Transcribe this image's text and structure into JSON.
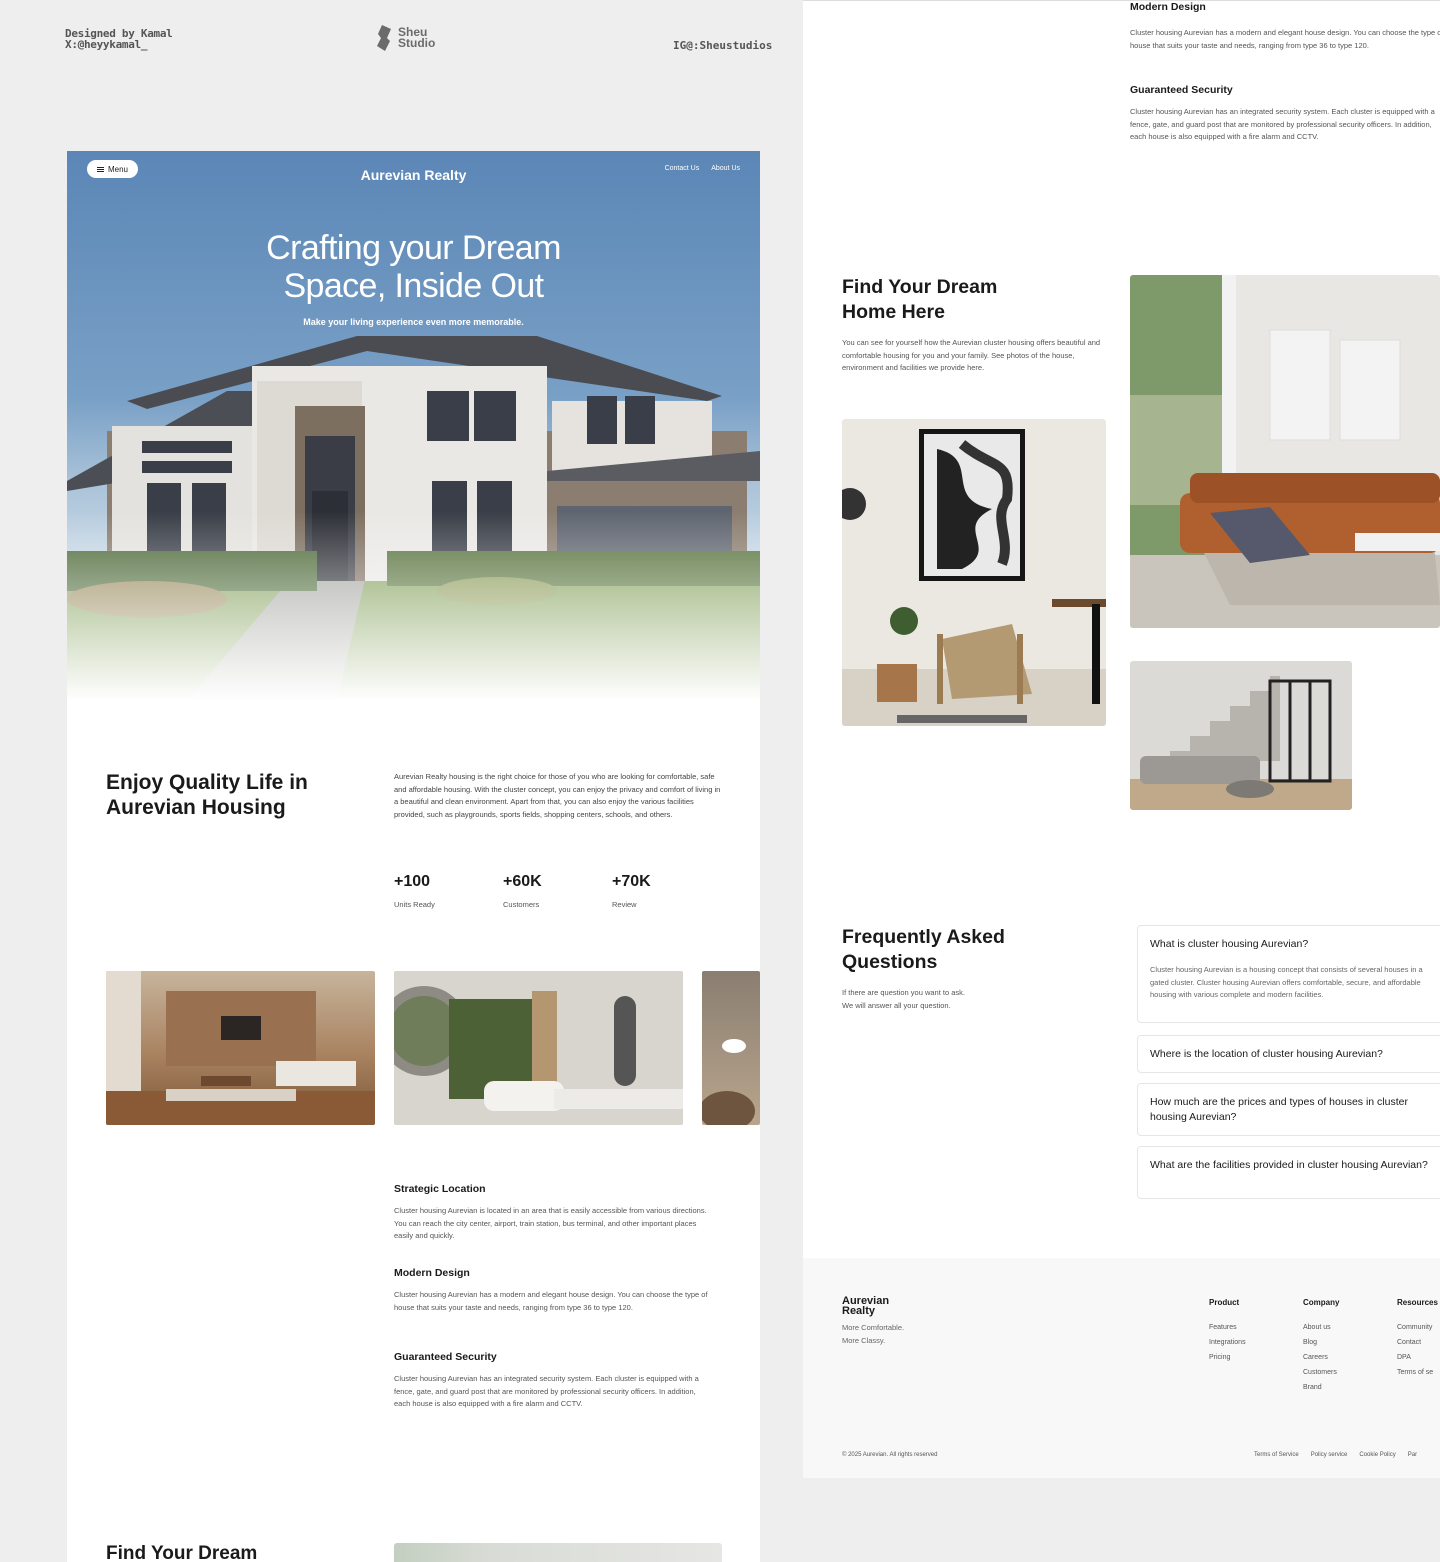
{
  "credits": {
    "designer": "Designed by Kamal",
    "x_handle": "X:@heyykamal_",
    "studio_line1": "Sheu",
    "studio_line2": "Studio",
    "instagram": "IG@:Sheustudios"
  },
  "site": {
    "menu_label": "Menu",
    "title": "Aurevian Realty",
    "nav": [
      "Contact Us",
      "About Us"
    ]
  },
  "hero": {
    "headline_line1": "Crafting your Dream",
    "headline_line2": "Space, Inside Out",
    "subtitle": "Make your living experience even more memorable."
  },
  "about": {
    "heading_line1": "Enjoy Quality Life in",
    "heading_line2": "Aurevian Housing",
    "body": "Aurevian Realty housing is the right choice for those of you who are looking for comfortable, safe and affordable housing. With the cluster concept, you can enjoy the privacy and comfort of living in a beautiful and clean environment. Apart from that, you can also enjoy the various facilities provided, such as playgrounds, sports fields, shopping centers, schools, and others.",
    "stats": [
      {
        "value": "+100",
        "label": "Units Ready"
      },
      {
        "value": "+60K",
        "label": "Customers"
      },
      {
        "value": "+70K",
        "label": "Review"
      }
    ]
  },
  "features": [
    {
      "title": "Strategic Location",
      "body": "Cluster housing Aurevian is located in an area that is easily accessible from various directions. You can reach the city center, airport, train station, bus terminal, and other important places easily and quickly."
    },
    {
      "title": "Modern Design",
      "body": "Cluster housing Aurevian has a modern and elegant house design. You can choose the type of house that suits your taste and needs, ranging from type 36 to type 120."
    },
    {
      "title": "Guaranteed Security",
      "body": "Cluster housing Aurevian has an integrated security system. Each cluster is equipped with a fence, gate, and guard post that are monitored by professional security officers. In addition, each house is also equipped with a fire alarm and CCTV."
    }
  ],
  "dream": {
    "heading_line1": "Find Your Dream",
    "heading_line2": "Home Here",
    "body": "You can see for yourself how the Aurevian cluster housing offers beautiful and comfortable housing for you and your family. See photos of the house, environment and facilities we provide here."
  },
  "faq": {
    "heading_line1": "Frequently Asked",
    "heading_line2": "Questions",
    "intro_line1": "If there are question you want to ask.",
    "intro_line2": "We will answer all your question.",
    "items": [
      {
        "q": "What is cluster housing Aurevian?",
        "a": "Cluster housing Aurevian is a housing concept that consists of several houses in a gated cluster. Cluster housing Aurevian offers comfortable, secure, and affordable housing with various complete and modern facilities.",
        "sign": "−"
      },
      {
        "q": "Where is the location of cluster housing Aurevian?",
        "sign": "+"
      },
      {
        "q": "How much are the prices and types of houses in cluster housing Aurevian?",
        "sign": "+"
      },
      {
        "q": "What are the facilities provided in cluster housing Aurevian?",
        "sign": "+"
      }
    ]
  },
  "footer": {
    "brand_line1": "Aurevian",
    "brand_line2": "Realty",
    "tagline_line1": "More Comfortable.",
    "tagline_line2": "More Classy.",
    "columns": [
      {
        "title": "Product",
        "items": [
          "Features",
          "Integrations",
          "Pricing"
        ]
      },
      {
        "title": "Company",
        "items": [
          "About us",
          "Blog",
          "Careers",
          "Customers",
          "Brand"
        ]
      },
      {
        "title": "Resources",
        "items": [
          "Community",
          "Contact",
          "DPA",
          "Terms of se"
        ]
      }
    ],
    "copyright": "© 2025 Aurevian. All rights reserved",
    "legal": [
      "Terms of Service",
      "Policy service",
      "Cookie Policy",
      "Par"
    ]
  },
  "colors": {
    "hero_sky": "#5b86b6",
    "page_bg": "#eeeeee",
    "text": "#1a1a1a"
  }
}
